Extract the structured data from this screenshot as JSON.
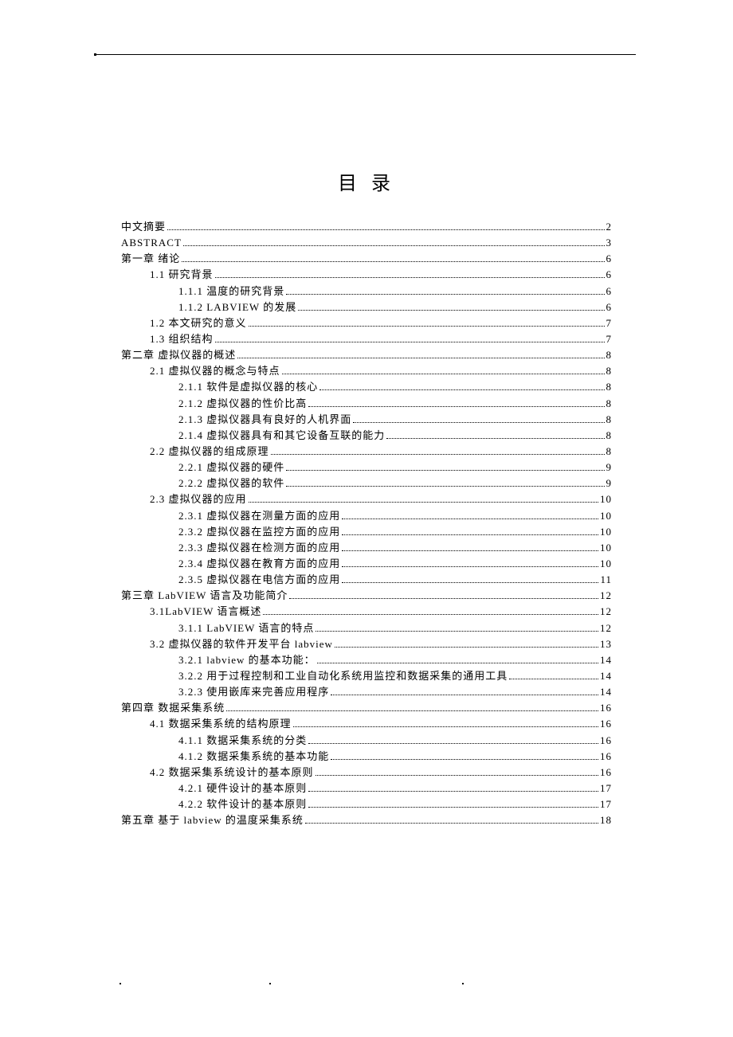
{
  "title": "目 录",
  "toc": [
    {
      "level": 0,
      "label": "中文摘要",
      "page": "2"
    },
    {
      "level": 0,
      "label": "ABSTRACT",
      "page": "3"
    },
    {
      "level": 0,
      "label": "第一章  绪论",
      "page": "6"
    },
    {
      "level": 1,
      "label": "1.1 研究背景",
      "page": "6"
    },
    {
      "level": 2,
      "label": "1.1.1 温度的研究背景",
      "page": "6"
    },
    {
      "level": 2,
      "label": "1.1.2 LABVIEW 的发展",
      "page": "6"
    },
    {
      "level": 1,
      "label": "1.2 本文研究的意义",
      "page": "7"
    },
    {
      "level": 1,
      "label": "1.3 组织结构",
      "page": "7"
    },
    {
      "level": 0,
      "label": "第二章  虚拟仪器的概述",
      "page": "8"
    },
    {
      "level": 1,
      "label": "2.1 虚拟仪器的概念与特点",
      "page": "8"
    },
    {
      "level": 2,
      "label": "2.1.1 软件是虚拟仪器的核心",
      "page": "8"
    },
    {
      "level": 2,
      "label": "2.1.2 虚拟仪器的性价比高",
      "page": "8"
    },
    {
      "level": 2,
      "label": "2.1.3 虚拟仪器具有良好的人机界面",
      "page": "8"
    },
    {
      "level": 2,
      "label": "2.1.4 虚拟仪器具有和其它设备互联的能力",
      "page": "8"
    },
    {
      "level": 1,
      "label": "2.2 虚拟仪器的组成原理",
      "page": "8"
    },
    {
      "level": 2,
      "label": "2.2.1 虚拟仪器的硬件",
      "page": "9"
    },
    {
      "level": 2,
      "label": "2.2.2 虚拟仪器的软件",
      "page": "9"
    },
    {
      "level": 1,
      "label": "2.3 虚拟仪器的应用",
      "page": "10"
    },
    {
      "level": 2,
      "label": "2.3.1 虚拟仪器在测量方面的应用",
      "page": "10"
    },
    {
      "level": 2,
      "label": "2.3.2 虚拟仪器在监控方面的应用",
      "page": "10"
    },
    {
      "level": 2,
      "label": "2.3.3 虚拟仪器在检测方面的应用",
      "page": "10"
    },
    {
      "level": 2,
      "label": "2.3.4 虚拟仪器在教育方面的应用",
      "page": "10"
    },
    {
      "level": 2,
      "label": "2.3.5 虚拟仪器在电信方面的应用",
      "page": "11"
    },
    {
      "level": 0,
      "label": "第三章 LabVIEW 语言及功能简介",
      "page": "12"
    },
    {
      "level": 1,
      "label": "3.1LabVIEW 语言概述",
      "page": "12"
    },
    {
      "level": 2,
      "label": "3.1.1 LabVIEW 语言的特点",
      "page": "12"
    },
    {
      "level": 1,
      "label": "3.2 虚拟仪器的软件开发平台 labview",
      "page": "13"
    },
    {
      "level": 2,
      "label": "3.2.1 labview 的基本功能：",
      "page": "14"
    },
    {
      "level": 2,
      "label": "3.2.2 用于过程控制和工业自动化系统用监控和数据采集的通用工具",
      "page": "14"
    },
    {
      "level": 2,
      "label": "3.2.3 使用嵌库来完善应用程序",
      "page": "14"
    },
    {
      "level": 0,
      "label": "第四章  数据采集系统",
      "page": "16"
    },
    {
      "level": 1,
      "label": "4.1 数据采集系统的结构原理",
      "page": "16"
    },
    {
      "level": 2,
      "label": "4.1.1 数据采集系统的分类",
      "page": "16"
    },
    {
      "level": 2,
      "label": "4.1.2 数据采集系统的基本功能",
      "page": "16"
    },
    {
      "level": 1,
      "label": "4.2 数据采集系统设计的基本原则",
      "page": "16"
    },
    {
      "level": 2,
      "label": "4.2.1 硬件设计的基本原则",
      "page": "17"
    },
    {
      "level": 2,
      "label": "4.2.2 软件设计的基本原则",
      "page": "17"
    },
    {
      "level": 0,
      "label": "第五章  基于 labview 的温度采集系统",
      "page": "18"
    }
  ]
}
